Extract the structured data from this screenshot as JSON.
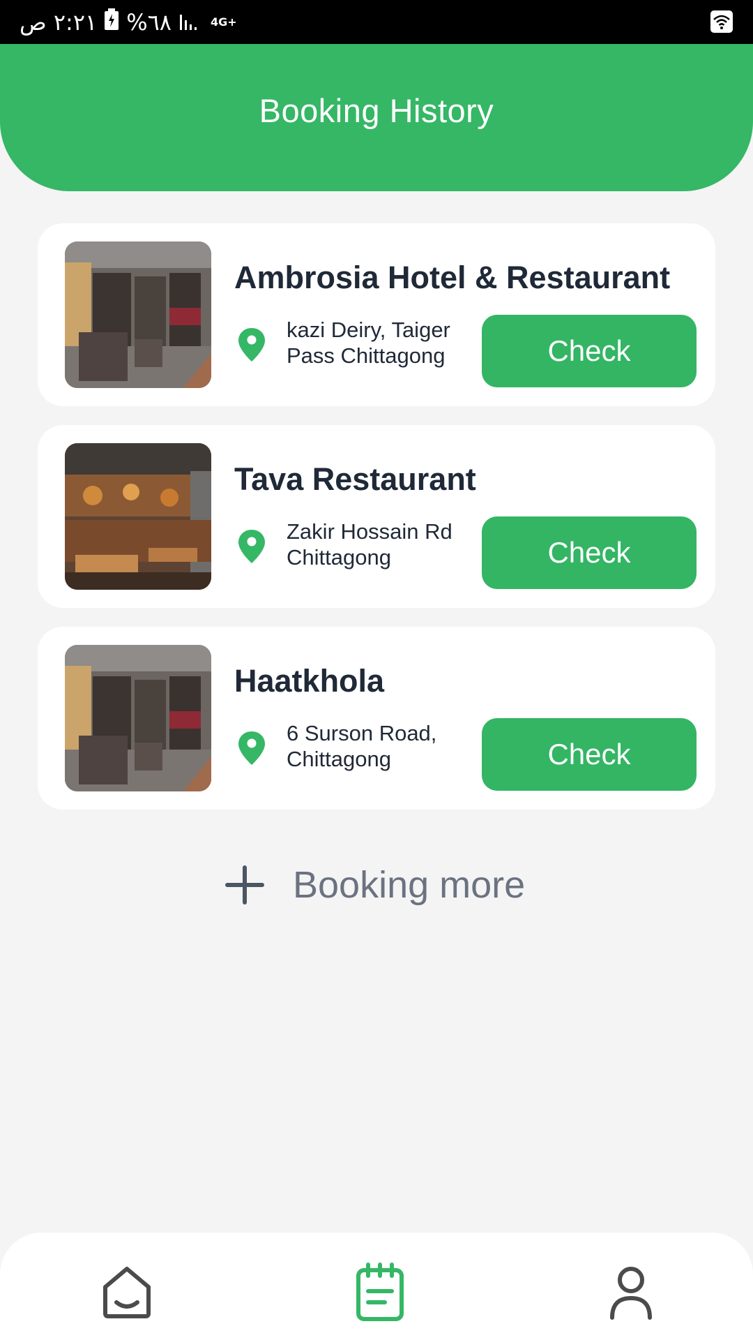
{
  "status_bar": {
    "time": "٢:٢١ ص",
    "battery": "%٦٨",
    "network": "4G+"
  },
  "header": {
    "title": "Booking History"
  },
  "bookings": [
    {
      "name": "Ambrosia Hotel & Restaurant",
      "address": "kazi Deiry, Taiger Pass Chittagong",
      "action": "Check",
      "image": "hotel-lobby-photo"
    },
    {
      "name": "Tava Restaurant",
      "address": "Zakir Hossain Rd Chittagong",
      "action": "Check",
      "image": "restaurant-dining-photo"
    },
    {
      "name": "Haatkhola",
      "address": "6 Surson Road, Chittagong",
      "action": "Check",
      "image": "hotel-lobby-photo"
    }
  ],
  "booking_more": {
    "label": "Booking more",
    "icon": "plus-icon"
  },
  "bottom_nav": {
    "items": [
      {
        "icon": "home-icon",
        "active": false
      },
      {
        "icon": "clipboard-icon",
        "active": true
      },
      {
        "icon": "user-icon",
        "active": false
      }
    ]
  },
  "colors": {
    "primary": "#35b766",
    "text_dark": "#1f2937",
    "text_muted": "#6b7280",
    "background": "#f4f4f4",
    "nav_inactive": "#4b4b4b"
  }
}
